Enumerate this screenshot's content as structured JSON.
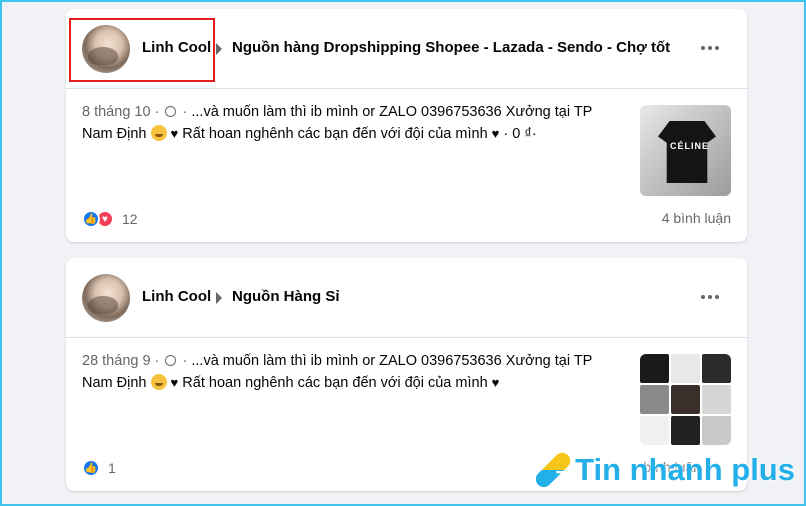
{
  "posts": [
    {
      "author": "Linh Cool",
      "group": "Nguồn hàng Dropshipping Shopee - Lazada - Sendo - Chợ tốt",
      "date": "8 tháng 10",
      "dot": "·",
      "line1": "...và muốn làm thì ib mình or ZALO 0396753636 Xưởng tại TP",
      "line2_prefix": "Nam Định",
      "line2_mid": "Rất hoan nghênh các bạn đến với đội của mình",
      "line2_suffix": "· 0 ₫·",
      "thumb_text": "CÉLINE",
      "reaction_count": "12",
      "comments": "4 bình luận"
    },
    {
      "author": "Linh Cool",
      "group": "Nguồn Hàng Sỉ",
      "date": "28 tháng 9",
      "dot": "·",
      "line1": "...và muốn làm thì ib mình or ZALO 0396753636 Xưởng tại TP",
      "line2_prefix": "Nam Định",
      "line2_mid": "Rất hoan nghênh các bạn đến với đội của mình",
      "reaction_count": "1",
      "comments": "bình luận"
    }
  ],
  "watermark": "Tin nhanh plus",
  "colors": {
    "accent": "#1877f2",
    "highlight": "#e41e1e",
    "watermark": "#23b0e8"
  }
}
